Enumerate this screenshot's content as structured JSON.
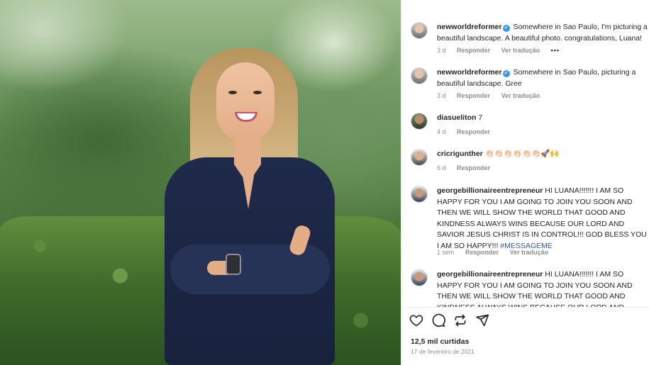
{
  "comments": [
    {
      "user": "newworldreformer",
      "verified": true,
      "text": "Somewhere in Sao Paulo, I'm picturing a beautiful landscape. A beautiful photo. congratulations, Luana!",
      "time": "3 d",
      "reply": "Responder",
      "translate": "Ver tradução",
      "more": "•••"
    },
    {
      "user": "newworldreformer",
      "verified": true,
      "text": "Somewhere in Sao Paulo, picturing a beautiful landscape. Gree",
      "time": "3 d",
      "reply": "Responder",
      "translate": "Ver tradução"
    },
    {
      "user": "diasueliton",
      "text": "7",
      "time": "4 d",
      "reply": "Responder"
    },
    {
      "user": "cricrigunther",
      "text": "👏🏻👏🏻👏🏻👏🏻👏🏻👏🏻🚀🙌",
      "time": "6 d",
      "reply": "Responder"
    },
    {
      "user": "georgebillionaireentrepreneur",
      "text": "HI LUANA!!!!!!! I AM SO HAPPY FOR YOU I AM GOING TO JOIN YOU SOON AND THEN WE WILL SHOW THE WORLD THAT GOOD AND KINDNESS ALWAYS WINS BECAUSE OUR LORD AND SAVIOR JESUS CHRIST IS IN CONTROL!!! GOD BLESS YOU I AM SO HAPPY!!!",
      "hashtag": "#MESSAGEME",
      "time": "1 sem",
      "reply": "Responder",
      "translate": "Ver tradução"
    },
    {
      "user": "georgebillionaireentrepreneur",
      "text": "HI LUANA!!!!!!! I AM SO HAPPY FOR YOU I AM GOING TO JOIN YOU SOON AND THEN WE WILL SHOW THE WORLD THAT GOOD AND KINDNESS ALWAYS WINS BECAUSE OUR LORD AND SAVIOR JESUS"
    }
  ],
  "post": {
    "likes": "12,5 mil curtidas",
    "date": "17 de fevereiro de 2021"
  },
  "icons": {
    "like": "heart-icon",
    "comment": "comment-icon",
    "share": "repost-icon",
    "send": "send-icon"
  },
  "colors": {
    "link": "#385898",
    "verified": "#3897f0",
    "secondary_text": "#8e8e8e"
  }
}
